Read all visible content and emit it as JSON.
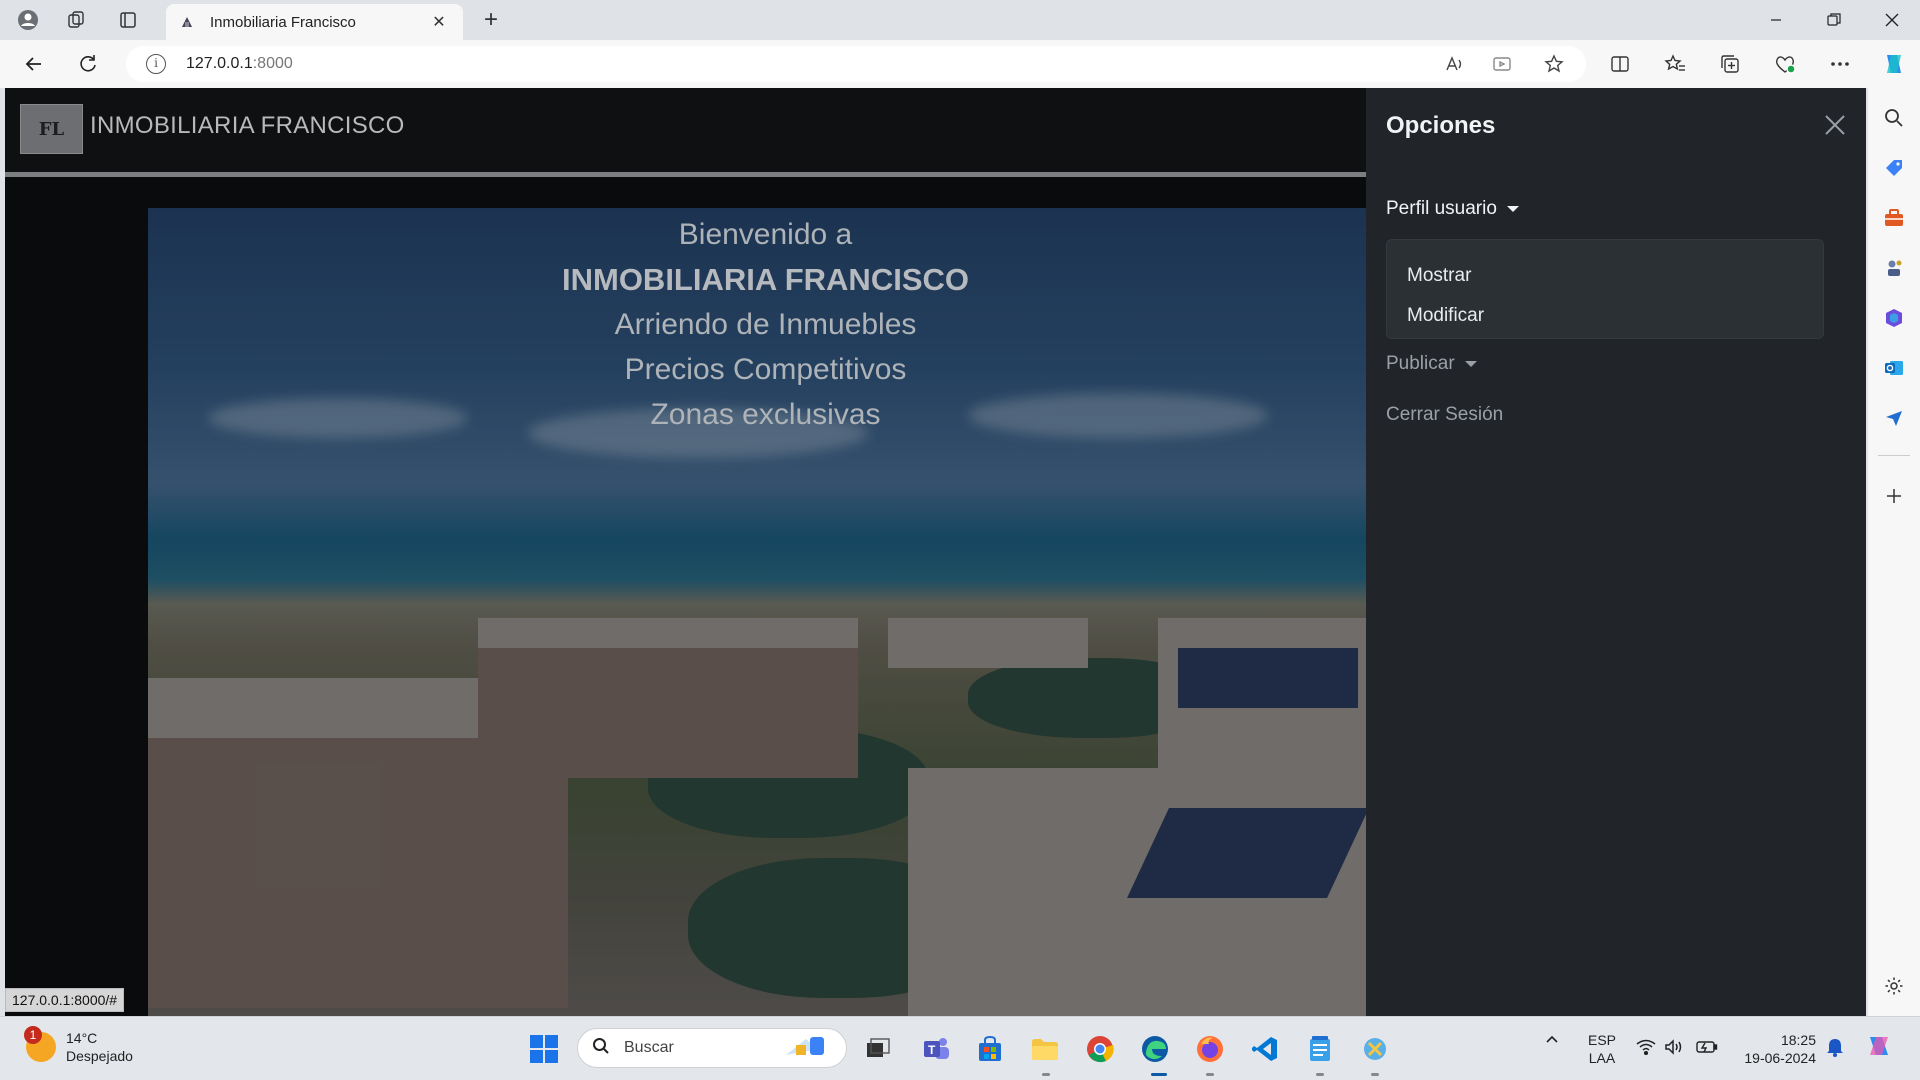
{
  "browser": {
    "tab_title": "Inmobiliaria Francisco",
    "tab_close": "✕",
    "new_tab": "+",
    "url_host": "127.0.0.1",
    "url_port": ":8000",
    "status_url": "127.0.0.1:8000/#"
  },
  "site": {
    "logo_text": "FL",
    "brand": "INMOBILIARIA FRANCISCO"
  },
  "hero": {
    "line1": "Bienvenido a",
    "line2": "INMOBILIARIA FRANCISCO",
    "line3": "Arriendo de Inmuebles",
    "line4": "Precios Competitivos",
    "line5": "Zonas exclusivas"
  },
  "offcanvas": {
    "title": "Opciones",
    "close": "✕",
    "perfil": "Perfil usuario",
    "dropdown_items": [
      "Mostrar",
      "Modificar"
    ],
    "publicar": "Publicar",
    "cerrar": "Cerrar Sesión"
  },
  "taskbar": {
    "weather_badge": "1",
    "temperature": "14°C",
    "condition": "Despejado",
    "search_placeholder": "Buscar",
    "lang1": "ESP",
    "lang2": "LAA",
    "time": "18:25",
    "date": "19-06-2024"
  },
  "colors": {
    "page_bg": "#0a0b0d",
    "offcanvas_bg": "#212529",
    "accent_edge": "#0c59a4"
  }
}
